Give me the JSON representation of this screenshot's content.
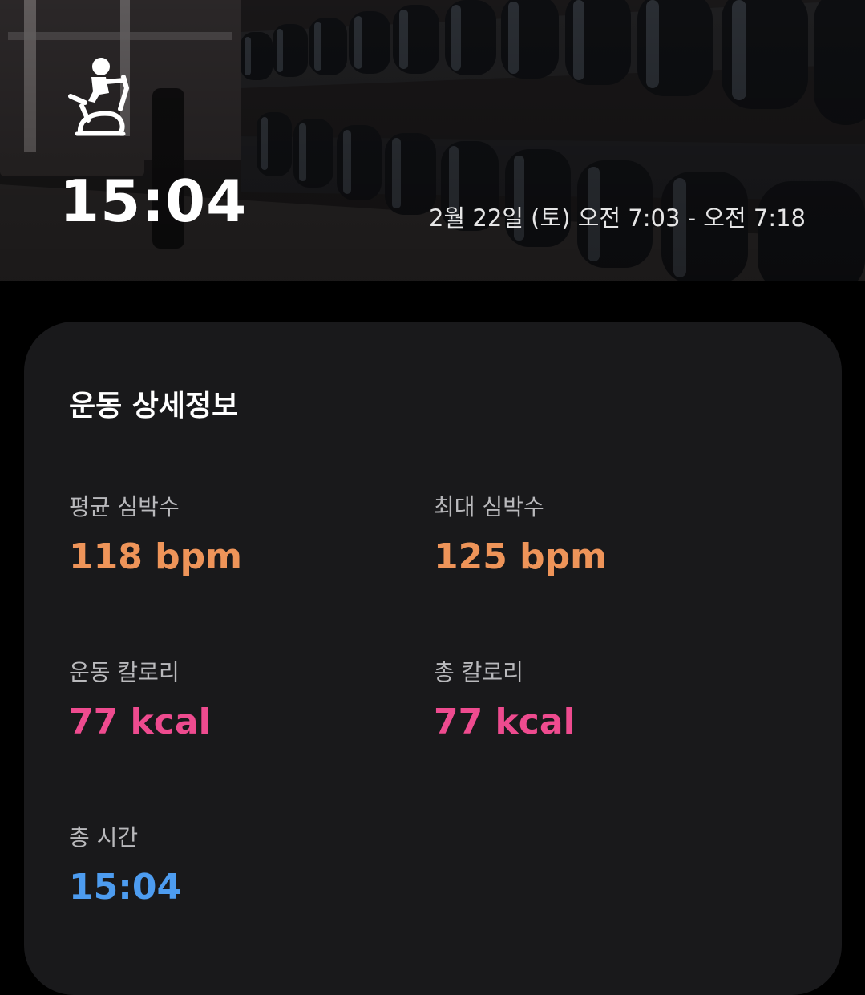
{
  "header": {
    "workout_icon": "stationary-bike-icon",
    "duration": "15:04",
    "date_range": "2월 22일 (토) 오전 7:03 - 오전 7:18"
  },
  "details": {
    "title": "운동 상세정보",
    "avg_heart_rate": {
      "label": "평균 심박수",
      "value": "118 bpm"
    },
    "max_heart_rate": {
      "label": "최대 심박수",
      "value": "125 bpm"
    },
    "workout_calories": {
      "label": "운동 칼로리",
      "value": "77 kcal"
    },
    "total_calories": {
      "label": "총 칼로리",
      "value": "77 kcal"
    },
    "total_time": {
      "label": "총 시간",
      "value": "15:04"
    }
  },
  "colors": {
    "heart_rate": "#ee9459",
    "calories": "#ee4b8f",
    "time": "#4d9cf0",
    "card_background": "#19191b",
    "page_background": "#000000"
  }
}
